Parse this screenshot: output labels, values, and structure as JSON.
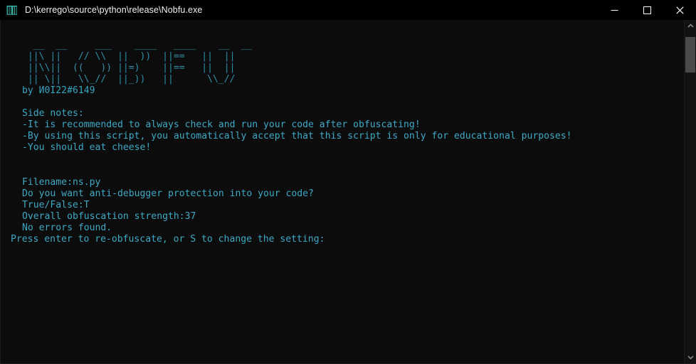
{
  "window": {
    "title": "D:\\kerrego\\source\\python\\release\\Nobfu.exe",
    "icon": "nobfu-app-icon",
    "controls": {
      "minimize_label": "Minimize",
      "maximize_label": "Maximize",
      "close_label": "Close"
    }
  },
  "theme": {
    "titlebar_bg": "#000000",
    "console_bg": "#0c0c0c",
    "text_color": "#3ea9c6",
    "banner_color": "#2f8fa8",
    "title_text_color": "#f0f0f0",
    "scrollbar_bg": "#121212",
    "scrollbar_thumb": "#4a4a4a"
  },
  "console": {
    "banner_ascii": "  __  __     ___    ____   ____    __  __\n ||\\ ||   // \\\\  ||  ))  ||==   ||  ||\n ||\\\\||  ((   )) ||=)    ||==   ||  ||\n || \\||   \\\\_//  ||_))   ||      \\\\_//",
    "banner_lines": [
      " __  __    ___    ___   ___    __ __",
      "||\\ ||   // \\\\  ||  ))  ||    ||  ||",
      "||\\\\||  ((   )) ||=)   ||==   ||  ||",
      "|| \\||   \\\\_//  ||_))  ||      \\\\_//"
    ],
    "byline": "by И0I22#6149",
    "notes_heading": "Side notes:",
    "notes": [
      "-It is recommended to always check and run your code after obfuscating!",
      "-By using this script, you automatically accept that this script is only for educational purposes!",
      "-You should eat cheese!"
    ],
    "prompts": [
      {
        "label": "Filename:",
        "value": "ns.py"
      },
      {
        "label": "Do you want anti-debugger protection into your code?",
        "value": ""
      },
      {
        "label": "True/False:",
        "value": "T"
      },
      {
        "label": "Overall obfuscation strength:",
        "value": "37"
      },
      {
        "label": "No errors found.",
        "value": ""
      }
    ],
    "prompt_lines": [
      "Filename:ns.py",
      "Do you want anti-debugger protection into your code?",
      "True/False:T",
      "Overall obfuscation strength:37",
      "No errors found."
    ],
    "final_line": "Press enter to re-obfuscate, or S to change the setting:"
  },
  "scrollbar": {
    "up_arrow": "chevron-up-icon",
    "down_arrow": "chevron-down-icon",
    "thumb_label": "scroll-thumb"
  }
}
